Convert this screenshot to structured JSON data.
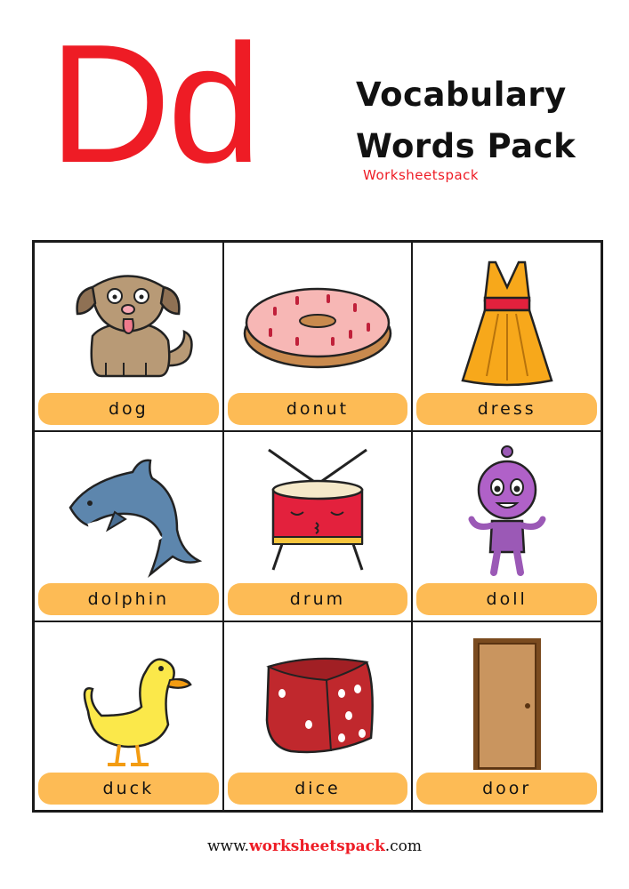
{
  "header": {
    "letter": "Dd",
    "title_line1": "Vocabulary",
    "title_line2": "Words Pack",
    "subtitle": "Worksheetspack"
  },
  "cards": [
    {
      "word": "dog",
      "icon": "dog-icon"
    },
    {
      "word": "donut",
      "icon": "donut-icon"
    },
    {
      "word": "dress",
      "icon": "dress-icon"
    },
    {
      "word": "dolphin",
      "icon": "dolphin-icon"
    },
    {
      "word": "drum",
      "icon": "drum-icon"
    },
    {
      "word": "doll",
      "icon": "doll-icon"
    },
    {
      "word": "duck",
      "icon": "duck-icon"
    },
    {
      "word": "dice",
      "icon": "dice-icon"
    },
    {
      "word": "door",
      "icon": "door-icon"
    }
  ],
  "footer": {
    "prefix": "www.",
    "brand": "worksheetspack",
    "suffix": ".com"
  },
  "colors": {
    "accent": "#ee1c25",
    "label_bg": "#fdbb55"
  }
}
